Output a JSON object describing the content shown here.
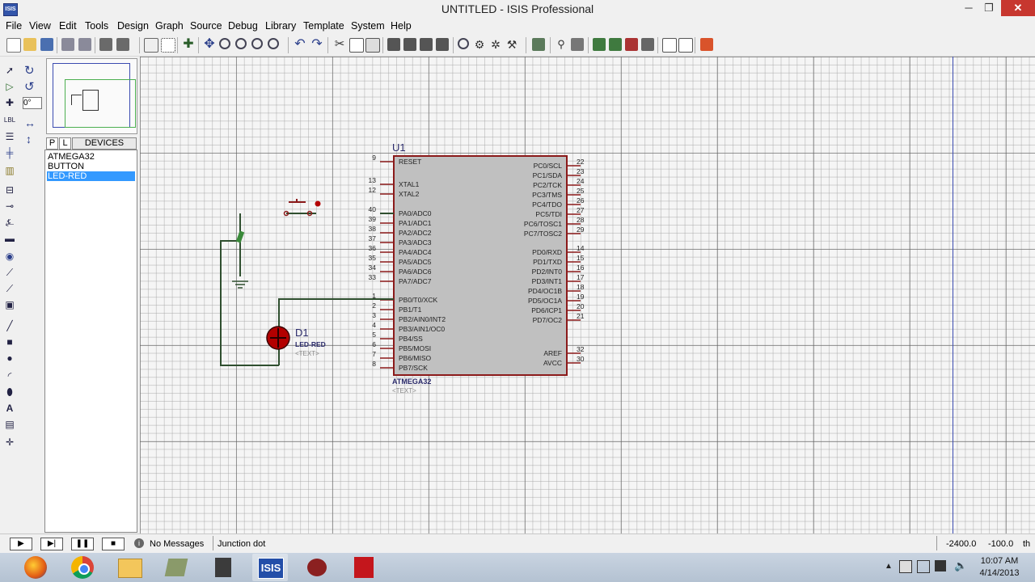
{
  "window": {
    "title": "UNTITLED - ISIS Professional",
    "icon_label": "ISIS",
    "minimize": "─",
    "restore": "❐",
    "close": "✕"
  },
  "menu": [
    "File",
    "View",
    "Edit",
    "Tools",
    "Design",
    "Graph",
    "Source",
    "Debug",
    "Library",
    "Template",
    "System",
    "Help"
  ],
  "left_panel": {
    "rotation_value": "0°",
    "tabs": {
      "p": "P",
      "l": "L",
      "title": "DEVICES"
    },
    "devices": [
      {
        "label": "ATMEGA32",
        "selected": false
      },
      {
        "label": "BUTTON",
        "selected": false
      },
      {
        "label": "LED-RED",
        "selected": true
      }
    ]
  },
  "schematic": {
    "mcu": {
      "ref": "U1",
      "part": "ATMEGA32",
      "text": "<TEXT>",
      "left_pins": [
        {
          "num": "9",
          "name": "RESET"
        },
        {
          "num": "13",
          "name": "XTAL1"
        },
        {
          "num": "12",
          "name": "XTAL2"
        },
        {
          "num": "40",
          "name": "PA0/ADC0"
        },
        {
          "num": "39",
          "name": "PA1/ADC1"
        },
        {
          "num": "38",
          "name": "PA2/ADC2"
        },
        {
          "num": "37",
          "name": "PA3/ADC3"
        },
        {
          "num": "36",
          "name": "PA4/ADC4"
        },
        {
          "num": "35",
          "name": "PA5/ADC5"
        },
        {
          "num": "34",
          "name": "PA6/ADC6"
        },
        {
          "num": "33",
          "name": "PA7/ADC7"
        },
        {
          "num": "1",
          "name": "PB0/T0/XCK"
        },
        {
          "num": "2",
          "name": "PB1/T1"
        },
        {
          "num": "3",
          "name": "PB2/AIN0/INT2"
        },
        {
          "num": "4",
          "name": "PB3/AIN1/OC0"
        },
        {
          "num": "5",
          "name": "PB4/SS"
        },
        {
          "num": "6",
          "name": "PB5/MOSI"
        },
        {
          "num": "7",
          "name": "PB6/MISO"
        },
        {
          "num": "8",
          "name": "PB7/SCK"
        }
      ],
      "right_pins": [
        {
          "num": "22",
          "name": "PC0/SCL"
        },
        {
          "num": "23",
          "name": "PC1/SDA"
        },
        {
          "num": "24",
          "name": "PC2/TCK"
        },
        {
          "num": "25",
          "name": "PC3/TMS"
        },
        {
          "num": "26",
          "name": "PC4/TDO"
        },
        {
          "num": "27",
          "name": "PC5/TDI"
        },
        {
          "num": "28",
          "name": "PC6/TOSC1"
        },
        {
          "num": "29",
          "name": "PC7/TOSC2"
        },
        {
          "num": "14",
          "name": "PD0/RXD"
        },
        {
          "num": "15",
          "name": "PD1/TXD"
        },
        {
          "num": "16",
          "name": "PD2/INT0"
        },
        {
          "num": "17",
          "name": "PD3/INT1"
        },
        {
          "num": "18",
          "name": "PD4/OC1B"
        },
        {
          "num": "19",
          "name": "PD5/OC1A"
        },
        {
          "num": "20",
          "name": "PD6/ICP1"
        },
        {
          "num": "21",
          "name": "PD7/OC2"
        },
        {
          "num": "32",
          "name": "AREF"
        },
        {
          "num": "30",
          "name": "AVCC"
        }
      ]
    },
    "led": {
      "ref": "D1",
      "part": "LED-RED",
      "text": "<TEXT>"
    },
    "colors": {
      "wire": "#2f4f2f",
      "mcu_body": "#c0c0c0",
      "mcu_border": "#8b1a1a",
      "led": "#b30000"
    }
  },
  "status": {
    "messages": "No Messages",
    "hint": "Junction dot",
    "coord_x": "-2400.0",
    "coord_y": "-100.0",
    "unit": "th"
  },
  "taskbar": {
    "time": "10:07 AM",
    "date": "4/14/2013",
    "apps": [
      "firefox-icon",
      "chrome-icon",
      "file-explorer-icon",
      "app-icon",
      "media-icon",
      "isis-icon",
      "proteus-ares-icon",
      "acrobat-icon"
    ]
  }
}
